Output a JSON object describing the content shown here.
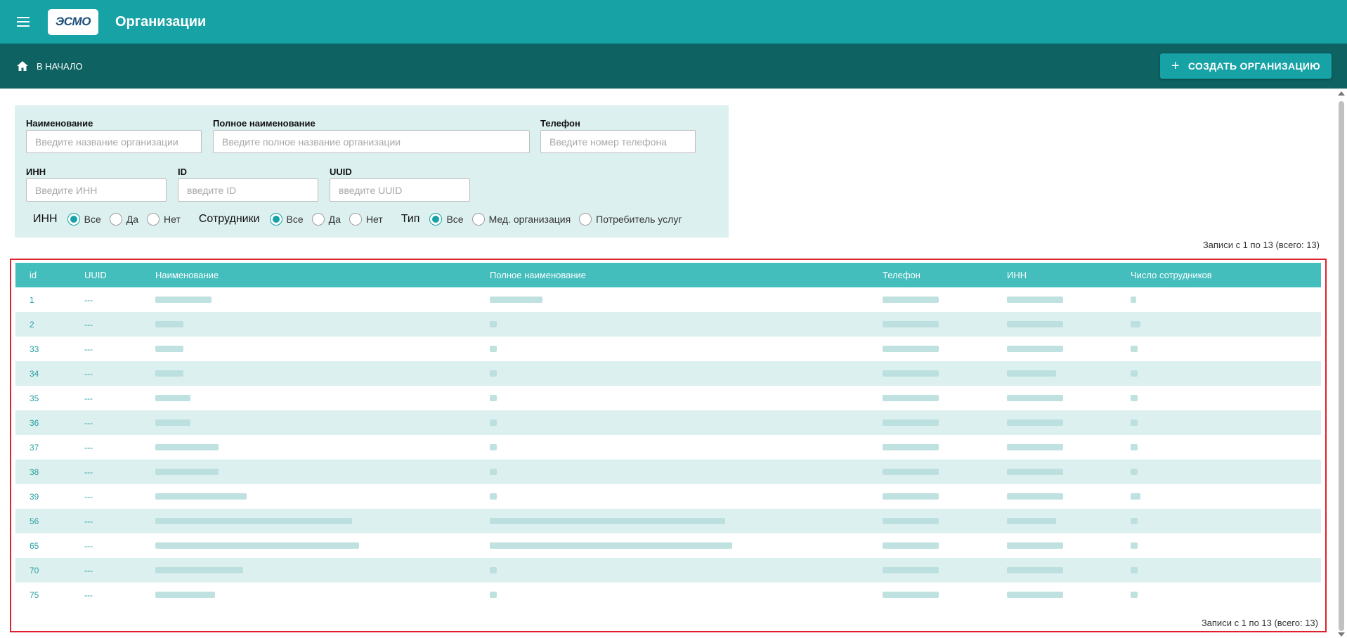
{
  "app": {
    "logo_text": "ЭСМО",
    "title": "Организации"
  },
  "toolbar": {
    "home_label": "В НАЧАЛО",
    "create_label": "СОЗДАТЬ ОРГАНИЗАЦИЮ"
  },
  "filters": {
    "name": {
      "label": "Наименование",
      "placeholder": "Введите название организации"
    },
    "full_name": {
      "label": "Полное наименование",
      "placeholder": "Введите полное название организации"
    },
    "phone": {
      "label": "Телефон",
      "placeholder": "Введите номер телефона"
    },
    "inn": {
      "label": "ИНН",
      "placeholder": "Введите ИНН"
    },
    "id": {
      "label": "ID",
      "placeholder": "введите ID"
    },
    "uuid": {
      "label": "UUID",
      "placeholder": "введите UUID"
    },
    "radio_groups": {
      "inn": {
        "label": "ИНН",
        "options": [
          "Все",
          "Да",
          "Нет"
        ],
        "selected": "Все"
      },
      "employees": {
        "label": "Сотрудники",
        "options": [
          "Все",
          "Да",
          "Нет"
        ],
        "selected": "Все"
      },
      "type": {
        "label": "Тип",
        "options": [
          "Все",
          "Мед. организация",
          "Потребитель услуг"
        ],
        "selected": "Все"
      }
    }
  },
  "records_info": "Записи с 1 по 13 (всего: 13)",
  "table": {
    "columns": [
      "id",
      "UUID",
      "Наименование",
      "Полное наименование",
      "Телефон",
      "ИНН",
      "Число сотрудников"
    ],
    "rows": [
      {
        "id": "1",
        "uuid": "---"
      },
      {
        "id": "2",
        "uuid": "---"
      },
      {
        "id": "33",
        "uuid": "---"
      },
      {
        "id": "34",
        "uuid": "---"
      },
      {
        "id": "35",
        "uuid": "---"
      },
      {
        "id": "36",
        "uuid": "---"
      },
      {
        "id": "37",
        "uuid": "---"
      },
      {
        "id": "38",
        "uuid": "---"
      },
      {
        "id": "39",
        "uuid": "---"
      },
      {
        "id": "56",
        "uuid": "---"
      },
      {
        "id": "65",
        "uuid": "---"
      },
      {
        "id": "70",
        "uuid": "---"
      },
      {
        "id": "75",
        "uuid": "---"
      }
    ]
  },
  "colors": {
    "primary": "#17a2a6",
    "toolbar": "#0e6262",
    "table_header": "#44bdbd",
    "row_alt": "#dcf0ef",
    "highlight_border": "#e0212b"
  },
  "icons": {
    "menu": "menu-icon",
    "home": "home-icon",
    "plus": "plus-icon"
  }
}
